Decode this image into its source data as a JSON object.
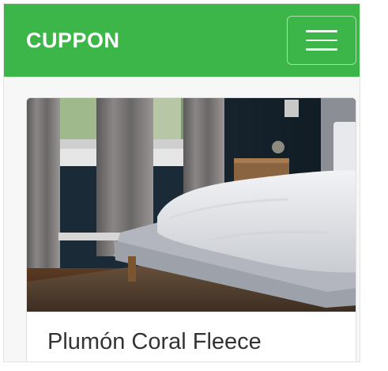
{
  "navbar": {
    "brand": "CUPPON",
    "brand_color": "#3cb649",
    "toggler_icon": "hamburger-menu-icon"
  },
  "product_card": {
    "image_description_icon": "bedroom-photo",
    "title": "Plumón Coral Fleece"
  }
}
